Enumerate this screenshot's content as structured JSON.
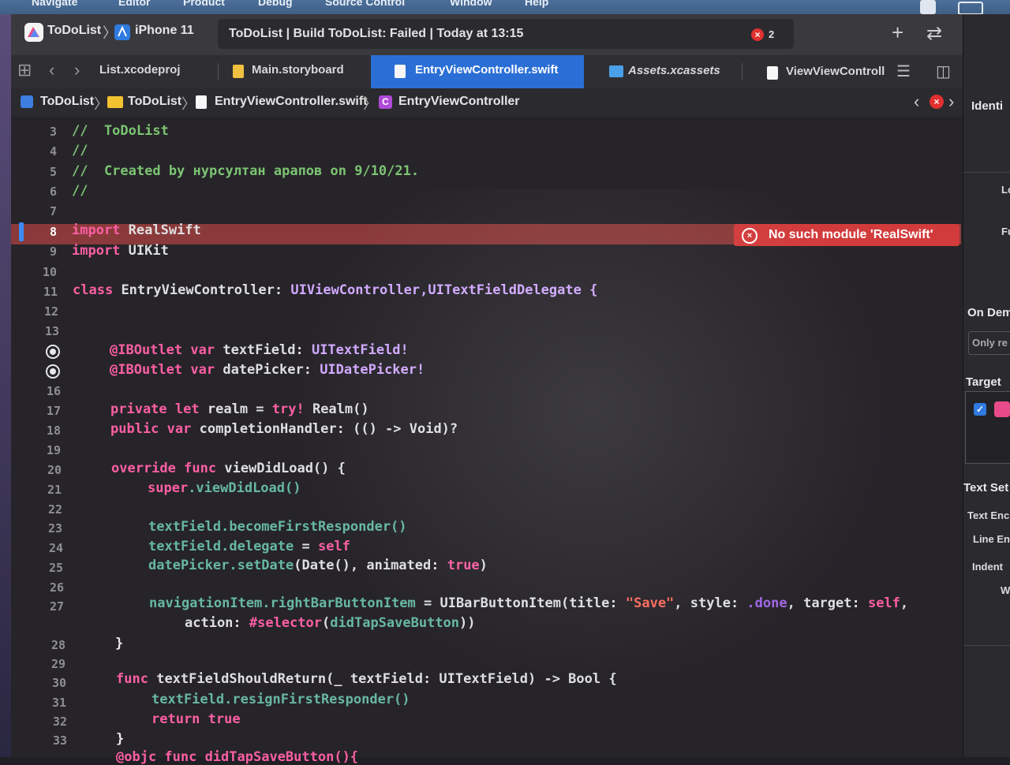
{
  "menubar": {
    "items": [
      "Navigate",
      "Editor",
      "Product",
      "Debug",
      "Source Control",
      "Window",
      "Help"
    ]
  },
  "toolbar": {
    "scheme": "ToDoList",
    "device": "iPhone 11",
    "status": "ToDoList | Build ToDoList: Failed | Today at 13:15",
    "error_count": "2",
    "add_glyph": "+",
    "swap_glyph": "⇄"
  },
  "tabs": [
    {
      "label": "List.xcodeproj",
      "icon": "xcodeproj-icon"
    },
    {
      "label": "Main.storyboard",
      "icon": "storyboard-icon"
    },
    {
      "label": "EntryViewController.swift",
      "icon": "swift-file-icon",
      "active": true
    },
    {
      "label": "Assets.xcassets",
      "icon": "asset-catalog-icon"
    },
    {
      "label": "ViewViewControll",
      "icon": "swift-file-icon"
    }
  ],
  "jumpbar": [
    "ToDoList",
    "ToDoList",
    "EntryViewController.swift",
    "EntryViewController"
  ],
  "error": {
    "message": "No such module 'RealSwift'"
  },
  "inspector": {
    "title": "Identi",
    "items": [
      "Lo",
      "Fu",
      "On Dem",
      "Only re",
      "Target",
      "Text Set",
      "Text Enc",
      "Line En",
      "Indent",
      "W"
    ]
  },
  "code": {
    "comment1": "//  ToDoList",
    "comment2": "//",
    "comment3": "//  Created by нурсултан арапов on 9/10/21.",
    "comment4": "//",
    "import": "import",
    "realswift": "RealSwift",
    "uikit": "UIKit",
    "class": "class",
    "classname": "EntryViewController:",
    "supers": "UIViewController,UITextFieldDelegate {",
    "iboutlet": "@IBOutlet",
    "var": "var",
    "textField": "textField:",
    "uitf": "UITextField!",
    "datePicker": "datePicker:",
    "uidp": "UIDatePicker!",
    "private": "private",
    "let": "let",
    "realm": "realm = ",
    "try": "try!",
    "realmcall": " Realm()",
    "public": "public",
    "completion": "completionHandler: (() -> Void)?",
    "override": "override",
    "func": "func",
    "viewDidLoad": "viewDidLoad() {",
    "super": "super",
    "superCall": ".viewDidLoad()",
    "line23a": "textField",
    "line23b": ".becomeFirstResponder()",
    "line24a": "textField",
    "line24b": ".delegate",
    "line24c": " = ",
    "self": "self",
    "line25a": "datePicker",
    "line25b": ".setDate",
    "line25c": "(Date(), animated: ",
    "true": "true",
    "line25d": ")",
    "line27a": "navigationItem",
    "line27b": ".rightBarButtonItem",
    "line27c": " = UIBarButtonItem(title: ",
    "saveStr": "\"Save\"",
    "line27d": ", style: ",
    "done": ".done",
    "line27e": ", target: ",
    "line27f": ",",
    "line27g": "action: ",
    "selector": "#selector",
    "line27h": "(",
    "didTap": "didTapSaveButton",
    "line27i": "))",
    "brace": "}",
    "tfsr": "textFieldShouldReturn(_ textField: UITextField) -> Bool {",
    "line31a": "textField",
    "line31b": ".resignFirstResponder()",
    "return": "return",
    "line33": "}",
    "line34": "@objc func didTapSaveButton(){"
  },
  "line_numbers": [
    "3",
    "4",
    "5",
    "6",
    "7",
    "8",
    "9",
    "10",
    "11",
    "12",
    "13",
    "16",
    "17",
    "18",
    "19",
    "20",
    "21",
    "22",
    "23",
    "24",
    "25",
    "26",
    "27",
    "28",
    "29",
    "30",
    "31",
    "32",
    "33"
  ]
}
